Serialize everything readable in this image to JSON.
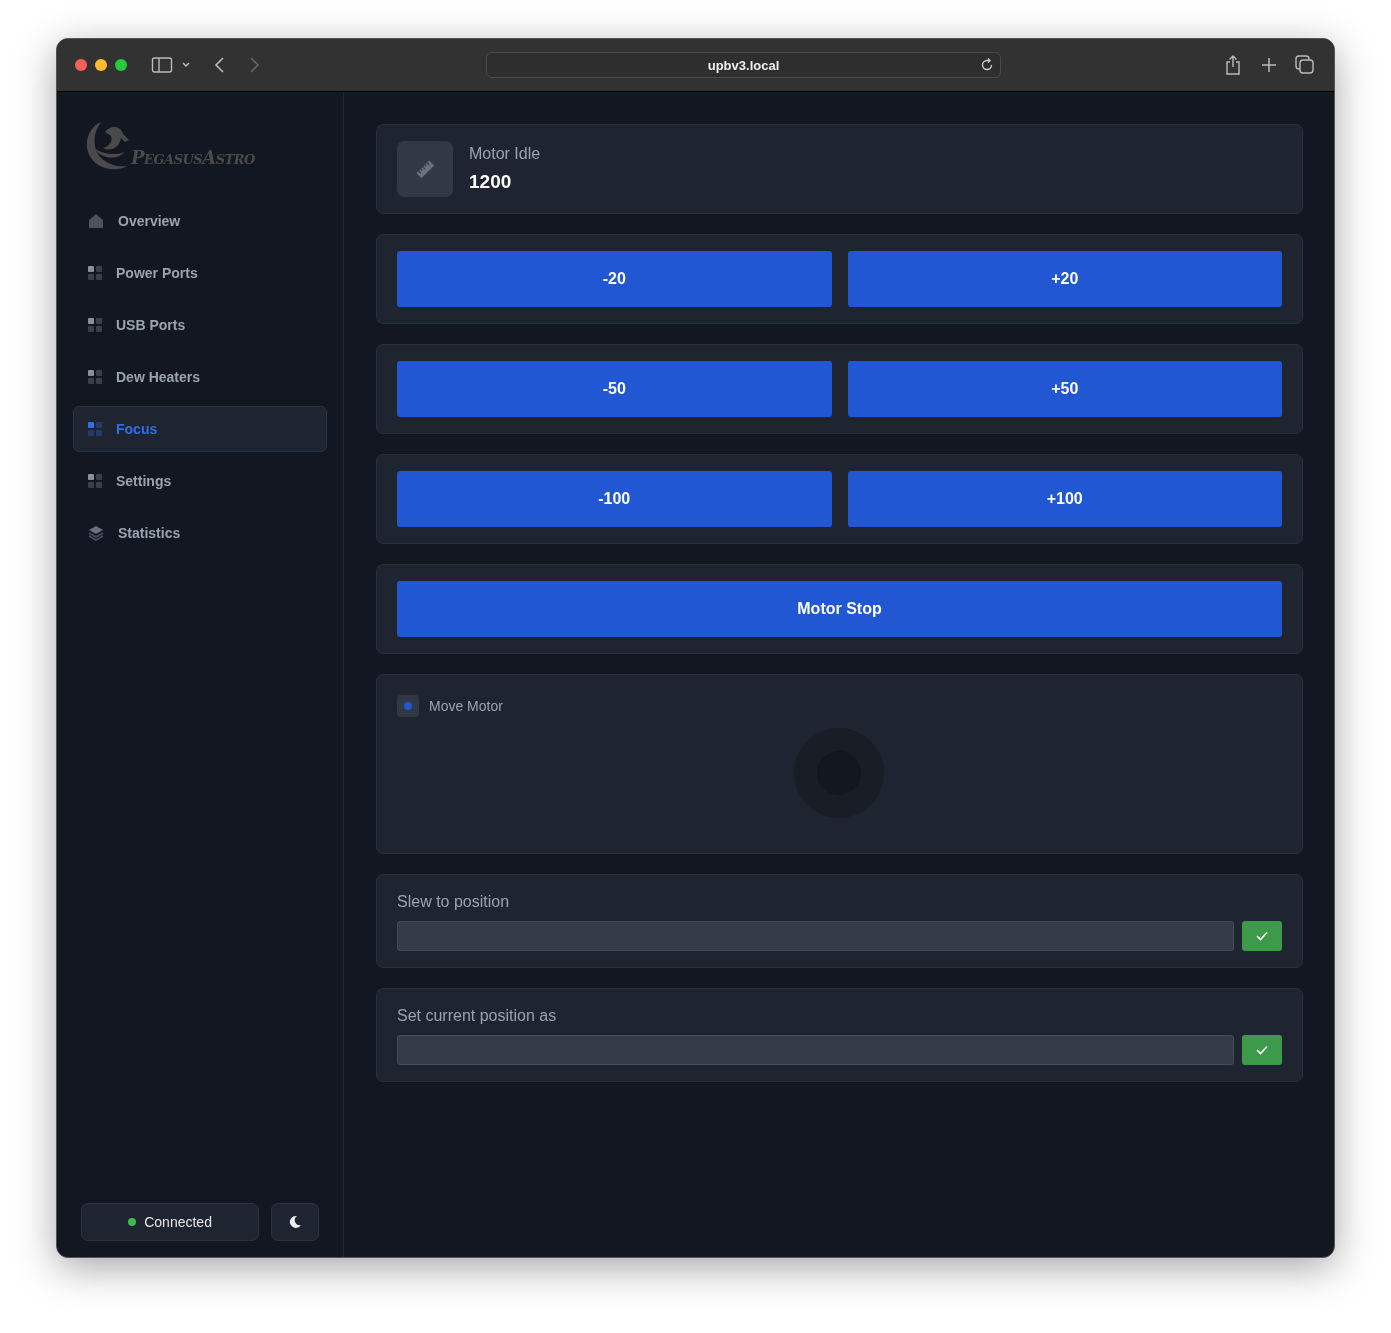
{
  "browser": {
    "url": "upbv3.local"
  },
  "sidebar": {
    "logo_text": "PegasusAstro",
    "nav": [
      {
        "label": "Overview",
        "kind": "home",
        "selected": false
      },
      {
        "label": "Power Ports",
        "kind": "grid",
        "selected": false
      },
      {
        "label": "USB Ports",
        "kind": "grid",
        "selected": false
      },
      {
        "label": "Dew Heaters",
        "kind": "grid",
        "selected": false
      },
      {
        "label": "Focus",
        "kind": "grid",
        "selected": true
      },
      {
        "label": "Settings",
        "kind": "grid",
        "selected": false
      },
      {
        "label": "Statistics",
        "kind": "layers",
        "selected": false
      }
    ],
    "status": {
      "label": "Connected",
      "connected": true
    }
  },
  "motor": {
    "label": "Motor Idle",
    "value": "1200"
  },
  "step_rows": [
    {
      "buttons": [
        "-20",
        "+20"
      ]
    },
    {
      "buttons": [
        "-50",
        "+50"
      ]
    },
    {
      "buttons": [
        "-100",
        "+100"
      ]
    },
    {
      "buttons": [
        "Motor Stop"
      ]
    }
  ],
  "move_motor": {
    "label": "Move Motor",
    "checked": true
  },
  "forms": [
    {
      "label": "Slew to position"
    },
    {
      "label": "Set current position as"
    }
  ]
}
